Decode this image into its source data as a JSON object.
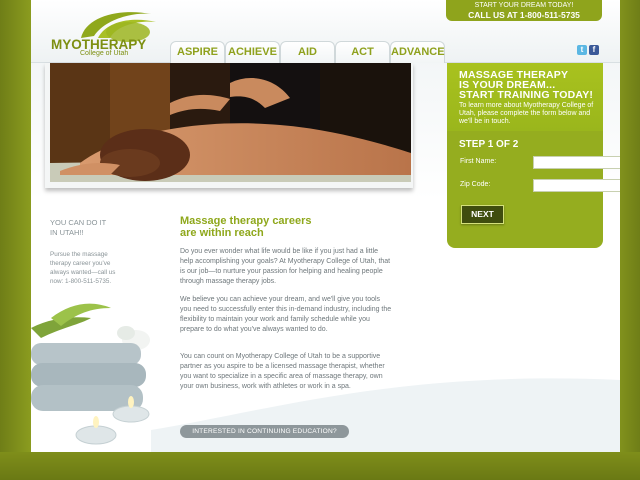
{
  "logo": {
    "name": "MYOTHERAPY",
    "subtitle": "College of Utah"
  },
  "nav": {
    "tabs": [
      "ASPIRE",
      "ACHIEVE",
      "AID",
      "ACT",
      "ADVANCE"
    ]
  },
  "cta_top": {
    "line1": "START YOUR DREAM TODAY!",
    "line2": "CALL US AT 1-800-511-5735"
  },
  "social": {
    "icons": [
      "twitter-icon",
      "facebook-icon"
    ]
  },
  "form": {
    "heading_line1": "MASSAGE THERAPY",
    "heading_line2": "IS YOUR DREAM...",
    "heading_line3": "START TRAINING TODAY!",
    "intro": "To learn more about Myotherapy College of Utah, please complete the form below and we'll be in touch.",
    "step": "STEP 1 OF 2",
    "first_name_label": "First Name:",
    "zip_label": "Zip Code:",
    "first_name_value": "",
    "zip_value": "",
    "next_label": "NEXT"
  },
  "sidebar": {
    "heading_line1": "YOU CAN DO IT",
    "heading_line2": "IN UTAH!!",
    "text": "Pursue the massage therapy career you've always wanted—call us now: 1-800-511-5735."
  },
  "main": {
    "heading_line1": "Massage therapy careers",
    "heading_line2": "are within reach",
    "paragraphs": [
      "Do you ever wonder what life would be like if you just had a little help accomplishing your goals? At Myotherapy College of Utah, that is our job—to nurture your passion for helping and healing people through massage therapy jobs.",
      "We believe you can achieve your dream, and we'll give you tools you need to successfully enter this in-demand industry, including the flexibility to maintain your work and family schedule while you prepare to do what you've always wanted to do.",
      "You can count on Myotherapy College of Utah to be a supportive partner as you aspire to be a licensed massage therapist, whether you want to specialize in a specific area of massage therapy, own your own business, work with athletes or work in a spa."
    ],
    "continuing_btn": "INTERESTED IN CONTINUING EDUCATION?"
  },
  "colors": {
    "accent": "#8fa81c",
    "dark_button": "#3f4d0e"
  }
}
